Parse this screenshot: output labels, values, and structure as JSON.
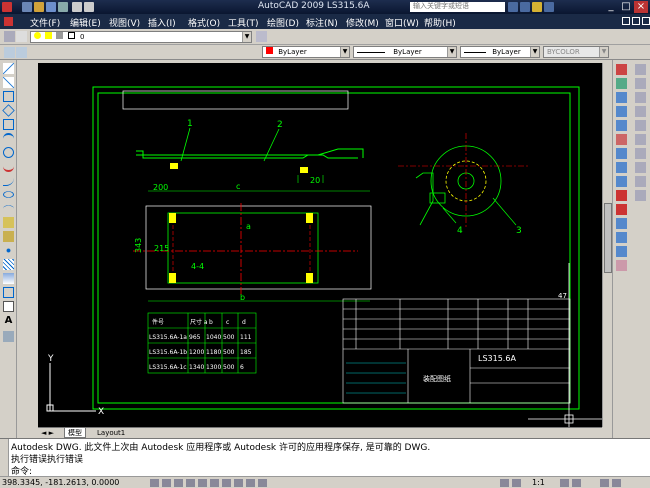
{
  "window": {
    "title": "AutoCAD 2009  LS315.6A",
    "search_placeholder": "输入关键字或短语",
    "buttons": [
      "_",
      "□",
      "×"
    ]
  },
  "menu": {
    "items": [
      "文件(F)",
      "编辑(E)",
      "视图(V)",
      "插入(I)",
      "格式(O)",
      "工具(T)",
      "绘图(D)",
      "标注(N)",
      "修改(M)",
      "窗口(W)",
      "帮助(H)"
    ]
  },
  "toolbar": {
    "layer_value": "0",
    "color_value": "ByLayer",
    "linetype_value": "ByLayer",
    "lineweight_value": "ByLayer",
    "plotstyle_value": "BYCOLOR"
  },
  "drawing": {
    "dim_200": "200",
    "dim_c": "c",
    "dim_a": "a",
    "dim_b": "b",
    "dim_343": "343",
    "dim_215": "215",
    "dim_20": "20",
    "dim_4x4": "4-4",
    "label_1": "1",
    "label_2": "2",
    "label_3": "3",
    "label_4": "4",
    "table_headers": [
      "件号",
      "尺寸 a",
      "b",
      "c",
      "d"
    ],
    "table_rows": [
      [
        "LS315.6A-1a",
        "965",
        "1040",
        "500",
        "111"
      ],
      [
        "LS315.6A-1b",
        "1200",
        "1180",
        "500",
        "185"
      ],
      [
        "LS315.6A-1c",
        "1340",
        "1300",
        "500",
        "6"
      ]
    ],
    "title_block_name": "LS315.6A",
    "title_block_sub": "装配图纸",
    "sheet_no": "47",
    "axis_y": "Y",
    "axis_x": "X"
  },
  "tabs": {
    "model": "模型",
    "layout1": "Layout1"
  },
  "command": {
    "line1": "Autodesk DWG.  此文件上次由 Autodesk 应用程序或 Autodesk 许可的应用程序保存, 是可靠的 DWG.",
    "line2": "执行错误执行错误",
    "line3": "命令:"
  },
  "status": {
    "coords": "398.3345, -181.2613, 0.0000",
    "scale": "1:1"
  },
  "colors": {
    "title_bg": "#0a1630",
    "menu_bg": "#1a2a46",
    "canvas_bg": "#000000",
    "cad_green": "#00ff00",
    "cad_yellow": "#ffff00",
    "cad_red": "#ff0000",
    "cad_cyan": "#00ffff",
    "cad_white": "#ffffff",
    "cad_magenta": "#ff00ff"
  }
}
